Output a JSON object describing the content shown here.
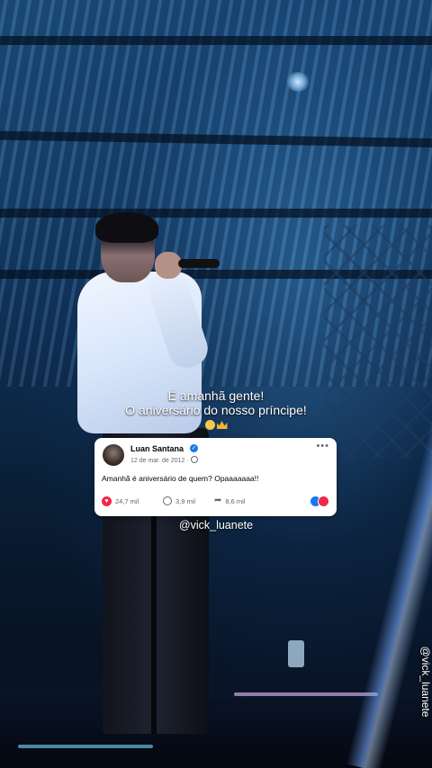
{
  "caption": {
    "line1": "É amanhã gente!",
    "line2": "O aniversário do nosso príncipe!",
    "emojis": [
      "pleading-face-icon",
      "crown-icon"
    ]
  },
  "post": {
    "author": "Luan Santana",
    "verified": true,
    "date": "12 de mar. de 2012 ·",
    "text": "Amanhã é aniversário de quem? Opaaaaaaa!!",
    "more_label": "•••",
    "likes": "24,7 mil",
    "comments": "3,9 mil",
    "shares": "8,6 mil",
    "colors": {
      "like": "#f0284a",
      "verified": "#1877f2"
    }
  },
  "credit_handle": "@vick_luanete",
  "watermark": "@vick_luanete"
}
